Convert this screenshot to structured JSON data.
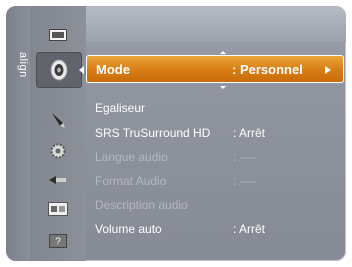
{
  "rail": {
    "label": "align"
  },
  "icons": [
    {
      "name": "picture-icon"
    },
    {
      "name": "sound-icon"
    },
    {
      "name": "channel-icon"
    },
    {
      "name": "setup-icon"
    },
    {
      "name": "input-icon"
    },
    {
      "name": "application-icon"
    },
    {
      "name": "support-icon",
      "glyph": "?"
    }
  ],
  "menu": {
    "selected": {
      "label": "Mode",
      "value": ": Personnel"
    },
    "items": [
      {
        "label": "Egaliseur",
        "value": ""
      },
      {
        "label": "SRS TruSurround HD",
        "value": ": Arrêt"
      },
      {
        "label": "Langue audio",
        "value": ": ----",
        "disabled": true
      },
      {
        "label": "Format Audio",
        "value": ": ----",
        "disabled": true
      },
      {
        "label": "Description audio",
        "value": "",
        "disabled": true
      },
      {
        "label": "Volume auto",
        "value": ": Arrêt"
      }
    ]
  },
  "colors": {
    "highlight": "#d97f16",
    "panel": "#8e939d",
    "disabled_text": "#b4b8bf"
  }
}
